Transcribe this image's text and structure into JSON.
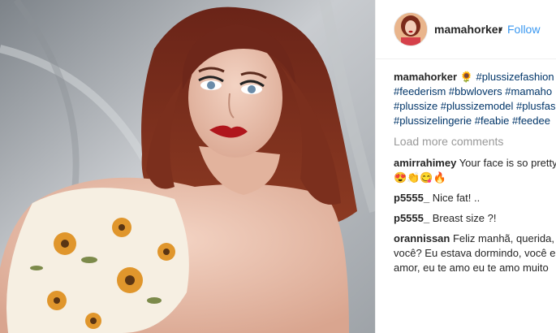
{
  "post": {
    "username": "mamahorker",
    "dot": "•",
    "follow_label": "Follow"
  },
  "caption": {
    "username": "mamahorker",
    "emoji": "🌻",
    "line1_tag": "#plussizefashion #",
    "line2": "#feederism #bbwlovers #mamaho",
    "line3": "#plussize #plussizemodel #plusfas",
    "line4": "#plussizelingerie #feabie #feedee"
  },
  "load_more": "Load more comments",
  "comments": [
    {
      "user": "amirrahimey",
      "text": " Your face is so pretty",
      "line2": "😍👏😋🔥"
    },
    {
      "user": "p5555_",
      "text": " Nice fat! .."
    },
    {
      "user": "p5555_",
      "text": " Breast size ?!"
    },
    {
      "user": "orannissan",
      "text": " Feliz manhã, querida, c",
      "line2": "você? Eu estava dormindo, você es",
      "line3": "amor, eu te amo eu te amo muito"
    }
  ],
  "colors": {
    "link": "#3897f0",
    "hashtag": "#003569",
    "muted": "#999999"
  },
  "icons": {
    "caption_emoji": "sunflower-icon"
  }
}
